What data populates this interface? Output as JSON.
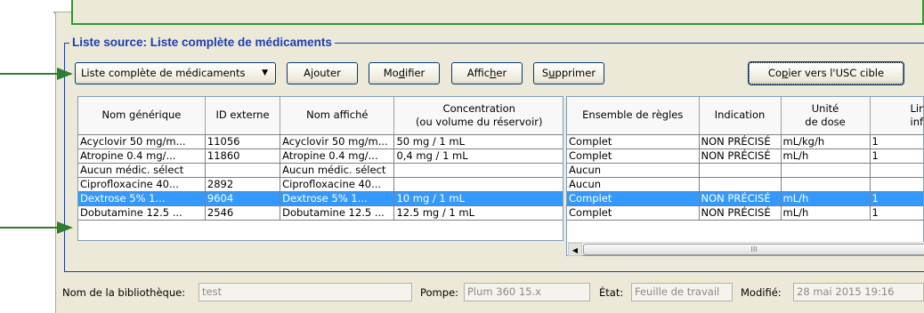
{
  "source_list": {
    "title": "Liste source: Liste complète de médicaments",
    "dropdown": {
      "selected": "Liste complète de médicaments"
    },
    "buttons": {
      "add": {
        "pre": "A",
        "u": "j",
        "post": "outer"
      },
      "modify": {
        "pre": "Mo",
        "u": "d",
        "post": "ifier"
      },
      "show": {
        "pre": "Affic",
        "u": "h",
        "post": "er"
      },
      "delete": {
        "pre": "S",
        "u": "u",
        "post": "pprimer"
      },
      "copy": {
        "pre": "Co",
        "u": "p",
        "post": "ier vers l'USC cible"
      }
    }
  },
  "left_table": {
    "columns": [
      "Nom générique",
      "ID externe",
      "Nom affiché",
      "Concentration",
      "(ou volume du réservoir)"
    ],
    "rows": [
      [
        "Acyclovir 50 mg/m...",
        "11056",
        "Acyclovir 50 mg/m...",
        "50 mg / 1 mL"
      ],
      [
        "Atropine 0.4 mg/...",
        "11860",
        "Atropine 0.4 mg/...",
        "0,4 mg / 1 mL"
      ],
      [
        "Aucun médic. sélect",
        "",
        "Aucun médic. sélect",
        ""
      ],
      [
        "Ciprofloxacine 40...",
        "2892",
        "Ciprofloxacine 40...",
        ""
      ],
      [
        "Dextrose  5%  1...",
        "9604",
        "Dextrose  5%  1...",
        "10 mg / 1 mL"
      ],
      [
        "Dobutamine 12.5 ...",
        "2546",
        "Dobutamine 12.5 ...",
        "12.5 mg / 1 mL"
      ]
    ],
    "selected_row": 4
  },
  "right_table": {
    "columns": [
      "Ensemble de règles",
      "Indication",
      "Unité",
      "de dose",
      "Limi",
      "infr"
    ],
    "rows": [
      [
        "Complet",
        "NON PRÉCISÉ",
        "mL/kg/h",
        "1"
      ],
      [
        "Complet",
        "NON PRÉCISÉ",
        "mL/h",
        "1"
      ],
      [
        "Aucun",
        "",
        "",
        ""
      ],
      [
        "Aucun",
        "",
        "",
        ""
      ],
      [
        "Complet",
        "NON PRÉCISÉ",
        "mL/h",
        "1"
      ],
      [
        "Complet",
        "NON PRÉCISÉ",
        "mL/h",
        "1"
      ]
    ],
    "scrollbar_grip": "III"
  },
  "status_bar": {
    "library_label": "Nom de la bibliothèque:",
    "library_value": "test",
    "pump_label": "Pompe:",
    "pump_value": "Plum 360 15.x",
    "state_label": "État:",
    "state_value": "Feuille de travail",
    "modified_label": "Modifié:",
    "modified_value": "28 mai 2015 19:16"
  },
  "colors": {
    "group_title": "#1c3fb0",
    "selection": "#3399ff",
    "callout_arrow": "#2e7d32",
    "panel_bg": "#ece9d8"
  },
  "icons": [
    "dropdown-arrow-icon",
    "scroll-left-icon",
    "callout-arrow-icon"
  ]
}
